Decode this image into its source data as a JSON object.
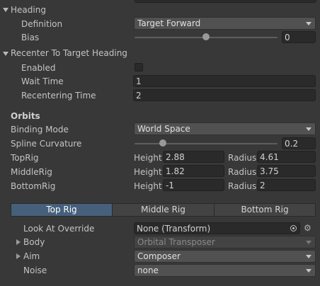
{
  "heading": {
    "title": "Heading",
    "definition_label": "Definition",
    "definition_value": "Target Forward",
    "bias_label": "Bias",
    "bias_value": "0",
    "bias_slider_fraction": 0.5
  },
  "recenter": {
    "title": "Recenter To Target Heading",
    "enabled_label": "Enabled",
    "enabled_checked": false,
    "wait_time_label": "Wait Time",
    "wait_time_value": "1",
    "recentering_time_label": "Recentering Time",
    "recentering_time_value": "2"
  },
  "orbits": {
    "title": "Orbits",
    "binding_mode_label": "Binding Mode",
    "binding_mode_value": "World Space",
    "spline_curvature_label": "Spline Curvature",
    "spline_curvature_value": "0.2",
    "spline_curvature_fraction": 0.2,
    "height_label": "Height",
    "radius_label": "Radius",
    "rigs": [
      {
        "name": "TopRig",
        "height": "2.88",
        "radius": "4.61"
      },
      {
        "name": "MiddleRig",
        "height": "1.82",
        "radius": "3.75"
      },
      {
        "name": "BottomRig",
        "height": "-1",
        "radius": "2"
      }
    ]
  },
  "rig_tabs": [
    "Top Rig",
    "Middle Rig",
    "Bottom Rig"
  ],
  "rig_tab_active": "Top Rig",
  "rig_settings": {
    "look_at_override_label": "Look At Override",
    "look_at_override_value": "None (Transform)",
    "body_label": "Body",
    "body_value": "Orbital Transposer",
    "aim_label": "Aim",
    "aim_value": "Composer",
    "noise_label": "Noise",
    "noise_value": "none"
  },
  "colors": {
    "background": "#383838",
    "active_tab": "#46607c",
    "field": "#2a2a2a",
    "dropdown": "#515151"
  }
}
